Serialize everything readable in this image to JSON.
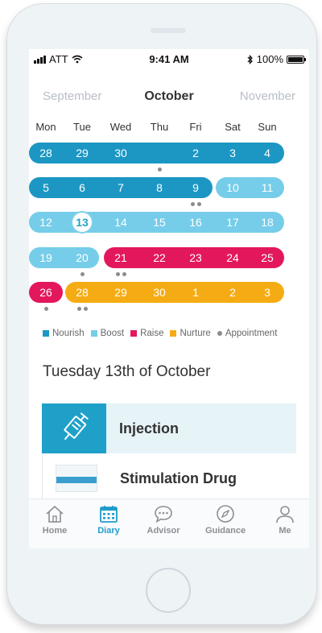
{
  "status_bar": {
    "carrier": "ATT",
    "time": "9:41 AM",
    "battery": "100%"
  },
  "calendar": {
    "prev_month": "September",
    "current_month": "October",
    "next_month": "November",
    "weekdays": [
      "Mon",
      "Tue",
      "Wed",
      "Thu",
      "Fri",
      "Sat",
      "Sun"
    ],
    "colors": {
      "nourish": "#1c97c3",
      "boost": "#76cde9",
      "raise": "#e3175c",
      "nurture": "#f5ac14"
    },
    "weeks": [
      {
        "segments": [
          {
            "type": "nourish",
            "from": 0,
            "to": 6
          }
        ],
        "days": [
          "28",
          "29",
          "30",
          "",
          "2",
          "3",
          "4"
        ],
        "dots": [
          0,
          0,
          0,
          1,
          0,
          0,
          0
        ]
      },
      {
        "segments": [
          {
            "type": "nourish",
            "from": 0,
            "to": 4
          },
          {
            "type": "boost",
            "from": 5,
            "to": 6
          }
        ],
        "days": [
          "5",
          "6",
          "7",
          "8",
          "9",
          "10",
          "11"
        ],
        "dots": [
          0,
          0,
          0,
          0,
          2,
          0,
          0
        ]
      },
      {
        "segments": [
          {
            "type": "boost",
            "from": 0,
            "to": 6
          }
        ],
        "days": [
          "12",
          "13",
          "14",
          "15",
          "16",
          "17",
          "18"
        ],
        "dots": [
          0,
          0,
          0,
          0,
          0,
          0,
          0
        ]
      },
      {
        "segments": [
          {
            "type": "boost",
            "from": 0,
            "to": 1
          },
          {
            "type": "raise",
            "from": 2,
            "to": 6
          }
        ],
        "days": [
          "19",
          "20",
          "21",
          "22",
          "23",
          "24",
          "25"
        ],
        "dots": [
          0,
          1,
          2,
          0,
          0,
          0,
          0
        ]
      },
      {
        "segments": [
          {
            "type": "raise",
            "from": 0,
            "to": 0
          },
          {
            "type": "nurture",
            "from": 1,
            "to": 6
          }
        ],
        "days": [
          "26",
          "28",
          "29",
          "30",
          "1",
          "2",
          "3"
        ],
        "dots": [
          1,
          2,
          0,
          0,
          0,
          0,
          0
        ]
      }
    ],
    "today": {
      "week": 2,
      "day": 1
    },
    "legend": [
      {
        "label": "Nourish",
        "color": "#1c97c3",
        "shape": "square"
      },
      {
        "label": "Boost",
        "color": "#76cde9",
        "shape": "square"
      },
      {
        "label": "Raise",
        "color": "#e3175c",
        "shape": "square"
      },
      {
        "label": "Nurture",
        "color": "#f5ac14",
        "shape": "square"
      },
      {
        "label": "Appointment",
        "color": "#8c8c8c",
        "shape": "dot"
      }
    ]
  },
  "selected_date_title": "Tuesday 13th of October",
  "entries": [
    {
      "label": "Injection",
      "icon": "syringe-icon"
    },
    {
      "label": "Stimulation Drug",
      "icon": "medicine-box-image"
    }
  ],
  "tabbar": [
    {
      "label": "Home",
      "icon": "home-icon",
      "active": false
    },
    {
      "label": "Diary",
      "icon": "calendar-icon",
      "active": true
    },
    {
      "label": "Advisor",
      "icon": "chat-bubble-icon",
      "active": false
    },
    {
      "label": "Guidance",
      "icon": "compass-icon",
      "active": false
    },
    {
      "label": "Me",
      "icon": "person-icon",
      "active": false
    }
  ]
}
